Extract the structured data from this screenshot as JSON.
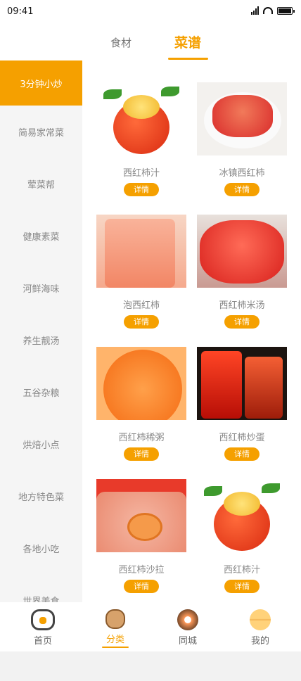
{
  "status": {
    "time": "09:41",
    "battery_level": 1.0
  },
  "top_tabs": [
    {
      "label": "食材",
      "active": false
    },
    {
      "label": "菜谱",
      "active": true
    }
  ],
  "sidebar": {
    "items": [
      {
        "label": "3分钟小炒",
        "active": true
      },
      {
        "label": "简易家常菜"
      },
      {
        "label": "荤菜帮"
      },
      {
        "label": "健康素菜"
      },
      {
        "label": "河鲜海味"
      },
      {
        "label": "养生靓汤"
      },
      {
        "label": "五谷杂粮"
      },
      {
        "label": "烘焙小点"
      },
      {
        "label": "地方特色菜"
      },
      {
        "label": "各地小吃"
      },
      {
        "label": "世界美食"
      }
    ]
  },
  "recipes": [
    {
      "name": "西红柿汁",
      "button": "详情",
      "image": "tomato-stuffed"
    },
    {
      "name": "冰镇西红柿",
      "button": "详情",
      "image": "chilled-tomato"
    },
    {
      "name": "泡西红柿",
      "button": "详情",
      "image": "tomato-juice-glass"
    },
    {
      "name": "西红柿米汤",
      "button": "详情",
      "image": "tomato-bowl"
    },
    {
      "name": "西红柿稀粥",
      "button": "详情",
      "image": "tomato-porridge"
    },
    {
      "name": "西红柿炒蛋",
      "button": "详情",
      "image": "tomato-jars"
    },
    {
      "name": "西红柿沙拉",
      "button": "详情",
      "image": "tomato-salad-spoon"
    },
    {
      "name": "西红柿汁",
      "button": "详情",
      "image": "tomato-stuffed"
    }
  ],
  "bottom_nav": [
    {
      "label": "首页",
      "icon": "bread-icon",
      "active": false
    },
    {
      "label": "分类",
      "icon": "biscuit-icon",
      "active": true
    },
    {
      "label": "同城",
      "icon": "donut-icon",
      "active": false
    },
    {
      "label": "我的",
      "icon": "macaron-icon",
      "active": false
    }
  ],
  "colors": {
    "accent": "#f5a000",
    "muted_text": "#888888",
    "sidebar_bg": "#f5f5f5"
  }
}
